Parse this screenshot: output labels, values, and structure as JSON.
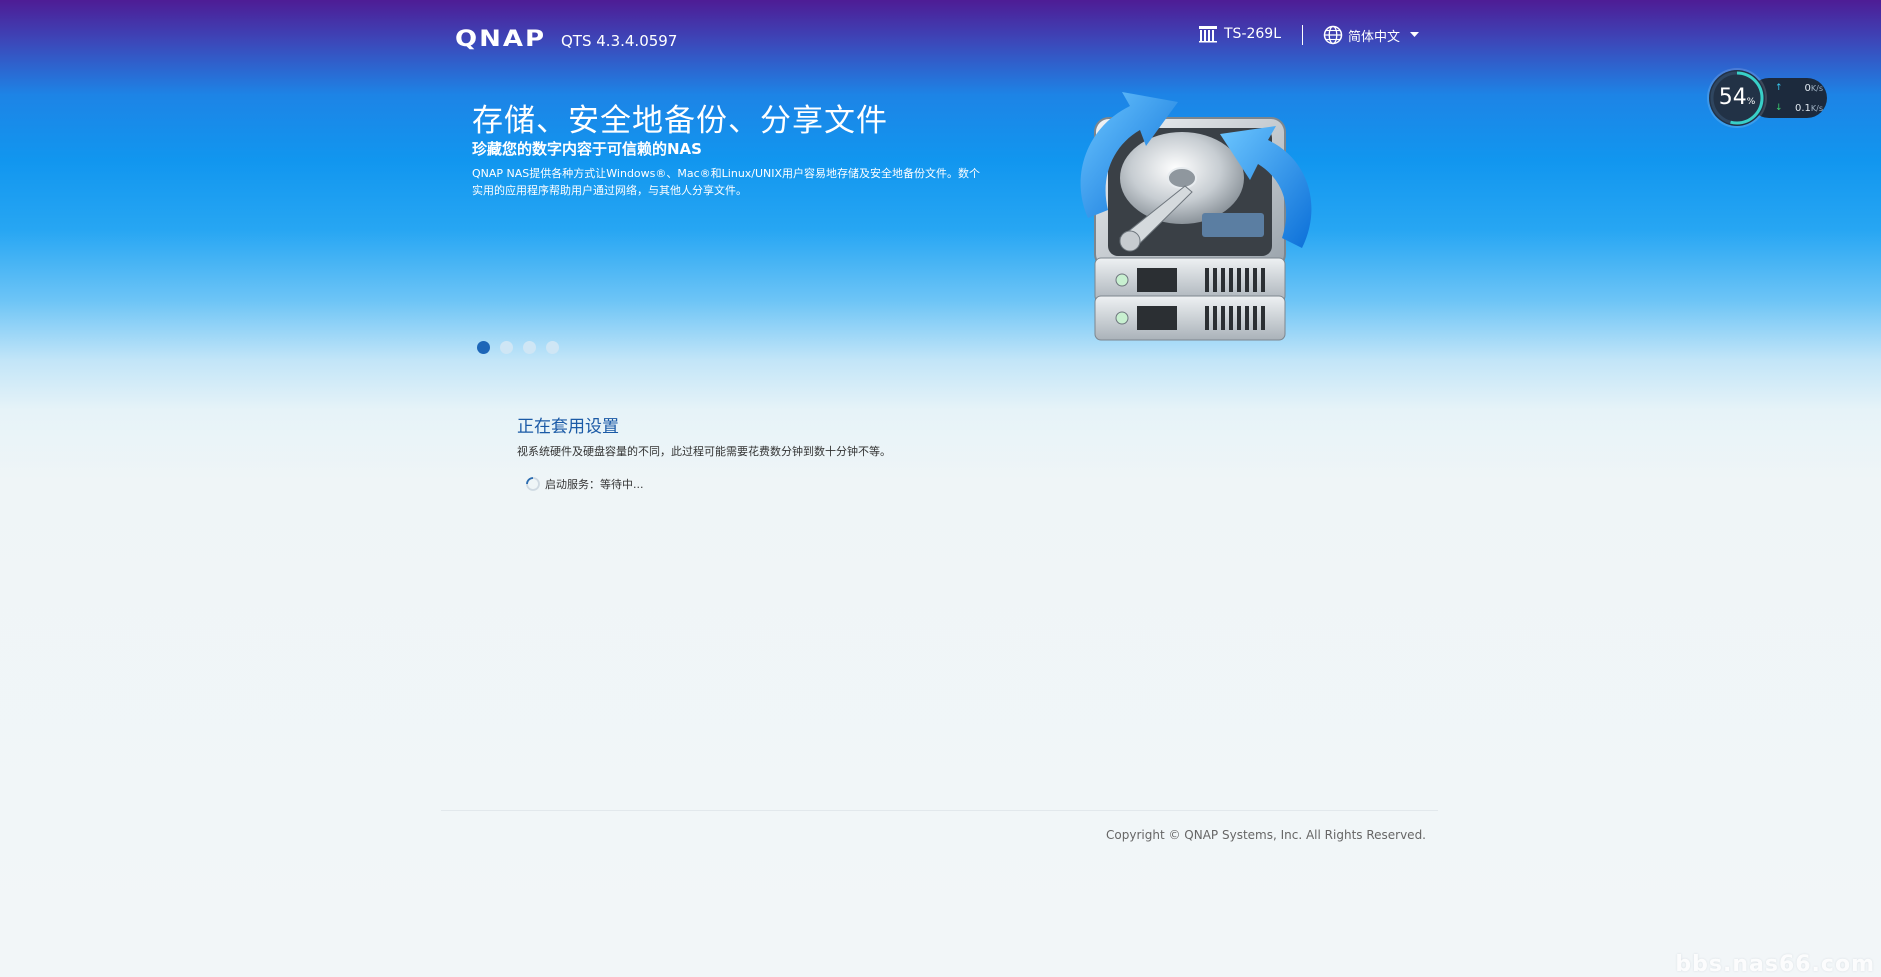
{
  "header": {
    "logo_text": "QNAP",
    "version": "QTS 4.3.4.0597",
    "model": "TS-269L",
    "language": "简体中文"
  },
  "monitor": {
    "cpu_percent": "54",
    "cpu_unit": "%",
    "upload_rate": "0",
    "download_rate": "0.1",
    "rate_unit": "K/s"
  },
  "hero": {
    "title": "存储、安全地备份、分享文件",
    "subtitle": "珍藏您的数字内容于可信赖的NAS",
    "description": "QNAP NAS提供各种方式让Windows®、Mac®和Linux/UNIX用户容易地存储及安全地备份文件。数个实用的应用程序帮助用户通过网络，与其他人分享文件。",
    "slides": 4,
    "active_slide": 1
  },
  "status": {
    "title": "正在套用设置",
    "description": "视系统硬件及硬盘容量的不同，此过程可能需要花费数分钟到数十分钟不等。",
    "step_text": "启动服务：等待中..."
  },
  "footer": {
    "copyright": "Copyright © QNAP Systems, Inc. All Rights Reserved."
  },
  "watermark": "bbs.nas66.com",
  "colors": {
    "status_title": "#1b5aa6",
    "active_dot": "#1d66b8",
    "inactive_dot": "#cfe6f5",
    "monitor_bg": "#1c2a3d"
  },
  "icons": {
    "model": "nas-device-icon",
    "language": "globe-icon",
    "caret": "caret-down-icon",
    "spinner": "loading-spinner-icon",
    "upload": "arrow-up-icon",
    "download": "arrow-down-icon",
    "hero": "hard-drive-sync-icon"
  }
}
